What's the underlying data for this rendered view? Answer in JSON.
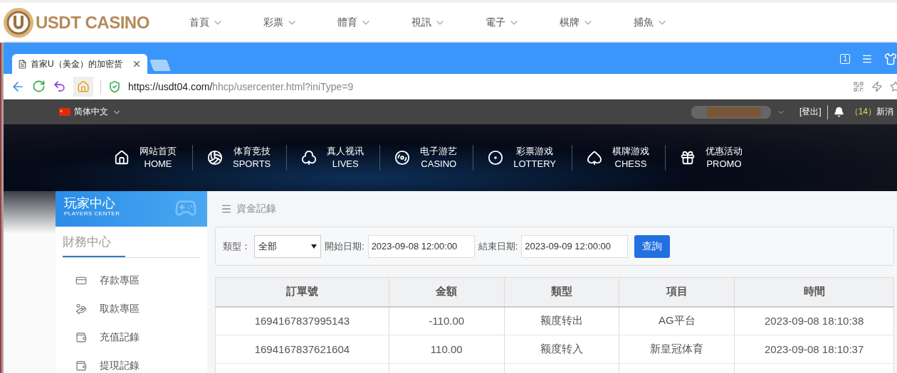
{
  "site_header": {
    "logo": "USDT CASINO",
    "menu": [
      {
        "label": "首頁"
      },
      {
        "label": "彩票"
      },
      {
        "label": "體育"
      },
      {
        "label": "視訊"
      },
      {
        "label": "電子"
      },
      {
        "label": "棋牌"
      },
      {
        "label": "捕魚"
      }
    ]
  },
  "browser": {
    "tabs": [
      {
        "title": "首家U（美金）的加密货",
        "selected": true
      }
    ],
    "window_badge": "1",
    "url_host": "https://usdt04.com/",
    "url_path": "hhcp/usercenter.html?iniType=9"
  },
  "top_bar": {
    "language": "简体中文",
    "logout": "[登出]",
    "message_count": "（14）",
    "messages": "新消"
  },
  "nav": [
    {
      "title": "网站首页",
      "subtitle": "HOME"
    },
    {
      "title": "体育竞技",
      "subtitle": "SPORTS"
    },
    {
      "title": "真人视讯",
      "subtitle": "LIVES"
    },
    {
      "title": "电子游艺",
      "subtitle": "CASINO"
    },
    {
      "title": "彩票游戏",
      "subtitle": "LOTTERY"
    },
    {
      "title": "棋牌游戏",
      "subtitle": "CHESS"
    },
    {
      "title": "优惠活动",
      "subtitle": "PROMO"
    }
  ],
  "sidebar": {
    "title": "玩家中心",
    "subtitle": "PLAYERS CENTER",
    "section": "財務中心",
    "items": [
      {
        "label": "存款專區"
      },
      {
        "label": "取款專區"
      },
      {
        "label": "充值記錄"
      },
      {
        "label": "提現記錄"
      }
    ]
  },
  "breadcrumb": "資金記錄",
  "filter": {
    "type_label": "類型：",
    "type_value": "全部",
    "start_label": "開始日期:",
    "start_value": "2023-09-08 12:00:00",
    "end_label": "結束日期:",
    "end_value": "2023-09-09 12:00:00",
    "button": "查詢"
  },
  "table": {
    "columns": [
      "訂單號",
      "金額",
      "類型",
      "項目",
      "時間"
    ],
    "rows": [
      [
        "1694167837995143",
        "-110.00",
        "额度转出",
        "AG平台",
        "2023-09-08 18:10:38"
      ],
      [
        "1694167837621604",
        "110.00",
        "额度转入",
        "新皇冠体育",
        "2023-09-08 18:10:37"
      ],
      [
        "",
        "",
        "",
        "",
        ""
      ]
    ]
  }
}
